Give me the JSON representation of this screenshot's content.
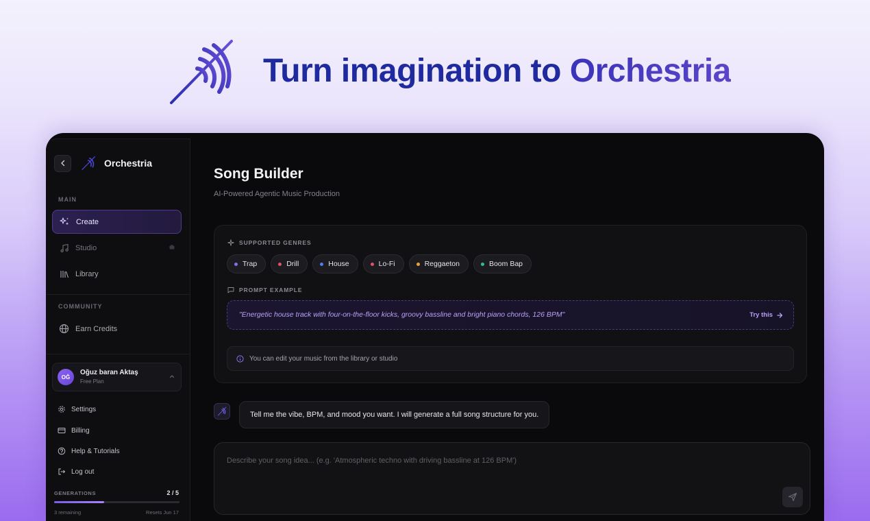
{
  "hero": {
    "title_prefix": "Turn imagination to ",
    "title_brand": "Orchestria"
  },
  "sidebar": {
    "brand": "Orchestria",
    "sections": {
      "main": "MAIN",
      "community": "COMMUNITY"
    },
    "nav": [
      {
        "label": "Create",
        "icon": "sparkles-icon",
        "active": true
      },
      {
        "label": "Studio",
        "icon": "music-note-icon",
        "active": false
      },
      {
        "label": "Library",
        "icon": "library-icon",
        "active": false
      }
    ],
    "community_nav": [
      {
        "label": "Earn Credits",
        "icon": "globe-icon"
      }
    ],
    "user": {
      "initials": "OĞ",
      "name": "Oğuz baran Aktaş",
      "plan": "Free Plan"
    },
    "menu": [
      {
        "label": "Settings",
        "icon": "gear-icon"
      },
      {
        "label": "Billing",
        "icon": "credit-card-icon"
      },
      {
        "label": "Help & Tutorials",
        "icon": "help-circle-icon"
      },
      {
        "label": "Log out",
        "icon": "logout-icon"
      }
    ],
    "generations": {
      "label": "GENERATIONS",
      "count": "2 / 5",
      "used": 2,
      "total": 5,
      "remaining": "3 remaining",
      "reset": "Resets Jun 17"
    }
  },
  "main": {
    "title": "Song Builder",
    "subtitle": "AI-Powered Agentic Music Production",
    "genres_label": "SUPPORTED GENRES",
    "genres": [
      {
        "label": "Trap",
        "color": "#8b6cf0"
      },
      {
        "label": "Drill",
        "color": "#e0506a"
      },
      {
        "label": "House",
        "color": "#4f7ef0"
      },
      {
        "label": "Lo-Fi",
        "color": "#e0506a"
      },
      {
        "label": "Reggaeton",
        "color": "#e6a23c"
      },
      {
        "label": "Boom Bap",
        "color": "#2fbf8f"
      }
    ],
    "prompt_label": "PROMPT EXAMPLE",
    "prompt_example": "\"Energetic house track with four-on-the-floor kicks, groovy bassline and bright piano chords, 126 BPM\"",
    "try_label": "Try this",
    "note": "You can edit your music from the library or studio",
    "bot_message": "Tell me the vibe, BPM, and mood you want. I will generate a full song structure for you.",
    "composer_placeholder": "Describe your song idea... (e.g. 'Atmospheric techno with driving bassline at 126 BPM')"
  },
  "colors": {
    "accent": "#8b6cf0",
    "hero_title": "#1f2a9e",
    "app_bg": "#0a0a0c"
  }
}
